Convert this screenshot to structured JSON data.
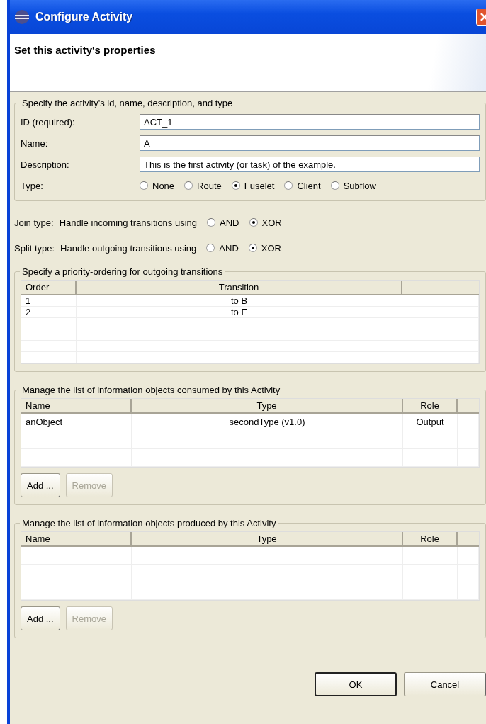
{
  "window": {
    "title": "Configure Activity"
  },
  "header": {
    "title": "Set this activity's properties"
  },
  "identity": {
    "legend": "Specify the activity's id, name, description, and type",
    "fields": [
      {
        "label": "ID (required):",
        "value": "ACT_1"
      },
      {
        "label": "Name:",
        "value": "A"
      },
      {
        "label": "Description:",
        "value": "This is the first activity (or task) of the example."
      }
    ],
    "type": {
      "label": "Type:",
      "options": [
        {
          "label": "None",
          "selected": false
        },
        {
          "label": "Route",
          "selected": false
        },
        {
          "label": "Fuselet",
          "selected": true
        },
        {
          "label": "Client",
          "selected": false
        },
        {
          "label": "Subflow",
          "selected": false
        }
      ]
    }
  },
  "join": {
    "label": "Join type:",
    "prompt": "Handle incoming transitions using",
    "options": [
      {
        "label": "AND",
        "selected": false
      },
      {
        "label": "XOR",
        "selected": true
      }
    ]
  },
  "split": {
    "label": "Split type:",
    "prompt": "Handle outgoing transitions using",
    "options": [
      {
        "label": "AND",
        "selected": false
      },
      {
        "label": "XOR",
        "selected": true
      }
    ]
  },
  "priority": {
    "legend": "Specify a priority-ordering for outgoing transitions",
    "columns": [
      "Order",
      "Transition"
    ],
    "rows": [
      [
        "1",
        "to B"
      ],
      [
        "2",
        "to E"
      ]
    ]
  },
  "consumed": {
    "legend": "Manage the list of information objects consumed by this Activity",
    "columns": [
      "Name",
      "Type",
      "Role"
    ],
    "rows": [
      [
        "anObject",
        "secondType (v1.0)",
        "Output"
      ]
    ],
    "buttons": [
      {
        "label": "Add ...",
        "disabled": false
      },
      {
        "label": "Remove",
        "disabled": true
      }
    ]
  },
  "produced": {
    "legend": "Manage the list of information objects produced by this Activity",
    "columns": [
      "Name",
      "Type",
      "Role"
    ],
    "buttons": [
      {
        "label": "Add ...",
        "disabled": false
      },
      {
        "label": "Remove",
        "disabled": true
      }
    ]
  },
  "buttons": [
    {
      "label": "OK",
      "default": true
    },
    {
      "label": "Cancel",
      "default": false
    }
  ]
}
